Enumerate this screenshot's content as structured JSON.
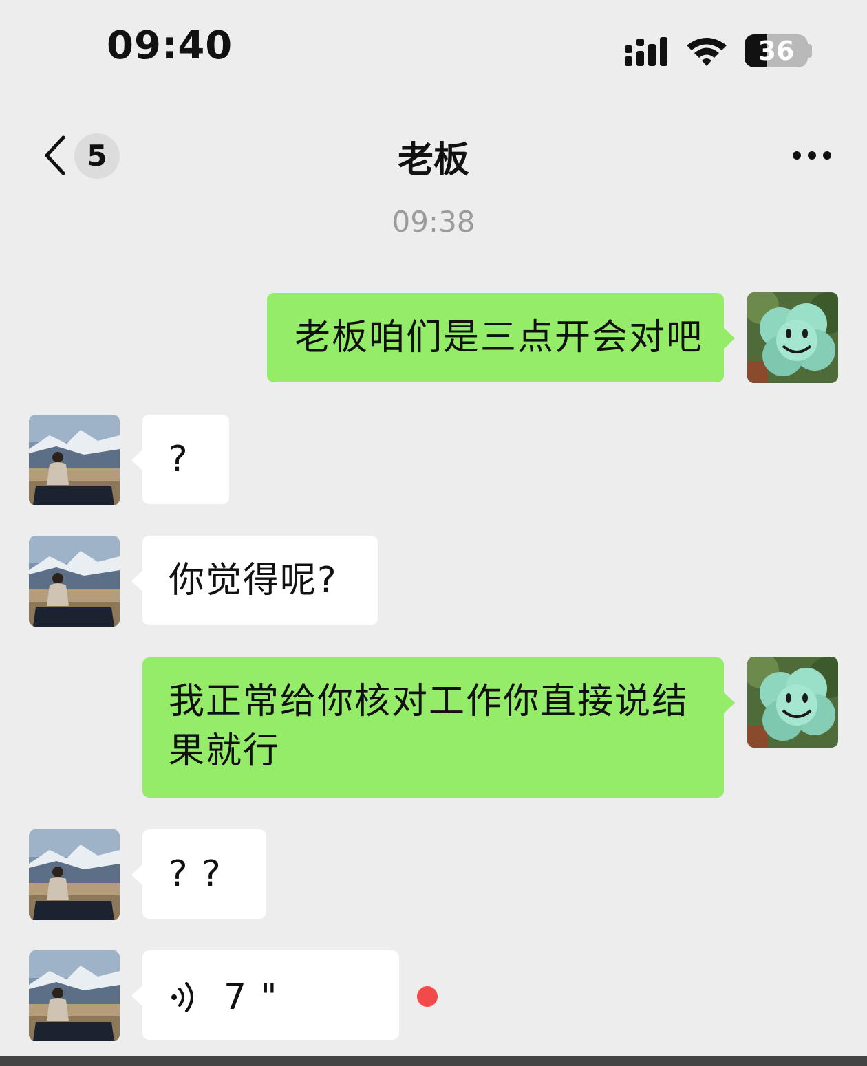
{
  "status_bar": {
    "time": "09:40",
    "battery_level": "36",
    "battery_fraction": 0.36
  },
  "nav": {
    "unread_count": "5",
    "title": "老板",
    "back_icon": "chevron-left-icon",
    "more_icon": "more-dots-icon"
  },
  "timestamp": "09:38",
  "messages": [
    {
      "direction": "out",
      "type": "text",
      "text": "老板咱们是三点开会对吧"
    },
    {
      "direction": "in",
      "type": "text",
      "text": "?"
    },
    {
      "direction": "in",
      "type": "text",
      "text": "你觉得呢?"
    },
    {
      "direction": "out",
      "type": "text",
      "text": "我正常给你核对工作你直接说结果就行"
    },
    {
      "direction": "in",
      "type": "text",
      "text": "? ?"
    },
    {
      "direction": "in",
      "type": "voice",
      "duration": "7 \"",
      "unread": true
    }
  ],
  "colors": {
    "background": "#ededed",
    "outgoing_bubble": "#95ec69",
    "incoming_bubble": "#ffffff",
    "unread_dot": "#f24a4a",
    "timestamp": "#9b9b9b"
  }
}
